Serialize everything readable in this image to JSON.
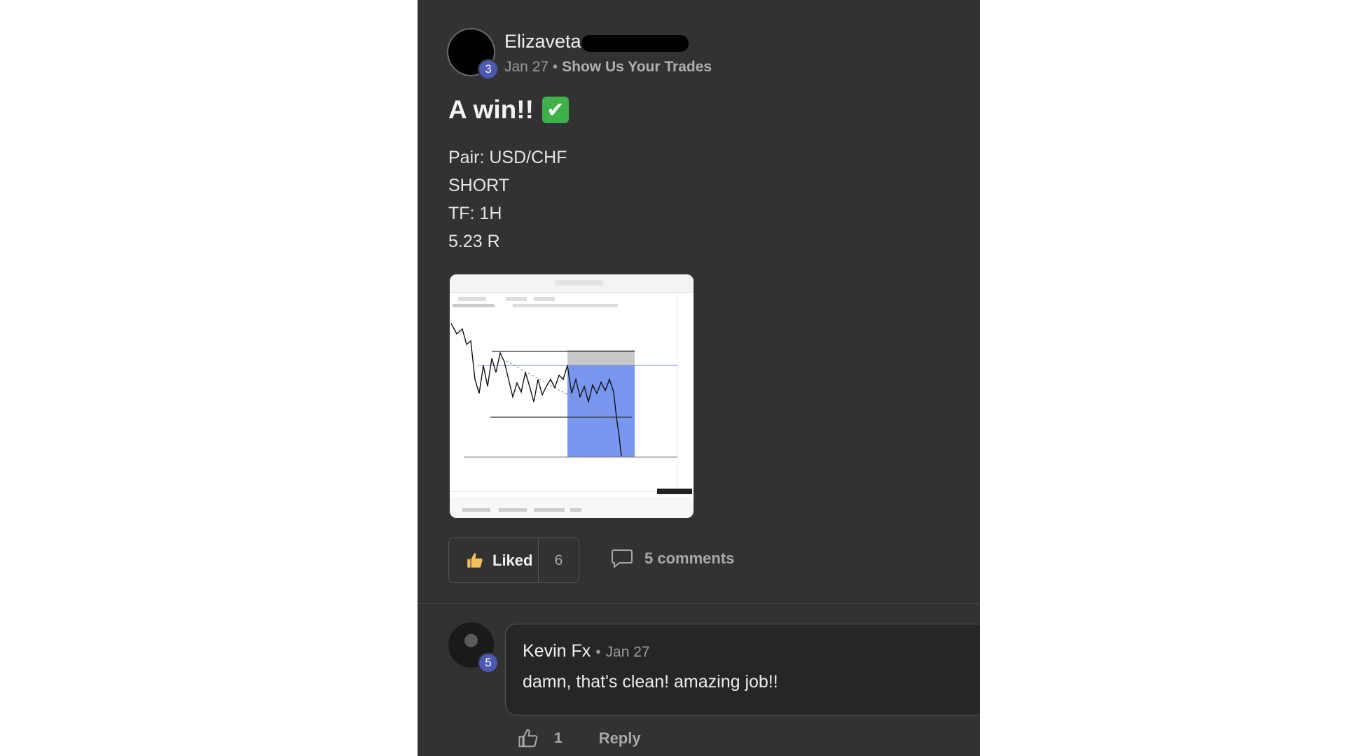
{
  "post": {
    "author": "Elizaveta",
    "author_level": "3",
    "date": "Jan 27",
    "separator": "•",
    "category": "Show Us Your Trades",
    "title": "A win!!",
    "title_emoji": "✔",
    "body_lines": [
      "Pair: USD/CHF",
      "SHORT",
      "TF: 1H",
      "5.23 R"
    ],
    "actions": {
      "liked_label": "Liked",
      "like_count": "6",
      "comments_label": "5 comments"
    }
  },
  "comment": {
    "author": "Kevin Fx",
    "author_level": "5",
    "separator": "•",
    "date": "Jan 27",
    "text": "damn, that's clean! amazing job!!",
    "like_count": "1",
    "reply_label": "Reply"
  },
  "colors": {
    "panel_bg": "#323232",
    "level_badge": "#4d57b4",
    "check_green": "#3db14a",
    "trade_zone_blue": "#7a97f0"
  },
  "icons": {
    "like": "thumbs-up-icon",
    "comments": "speech-bubble-icon",
    "comment_like": "thumbs-up-outline-icon"
  }
}
